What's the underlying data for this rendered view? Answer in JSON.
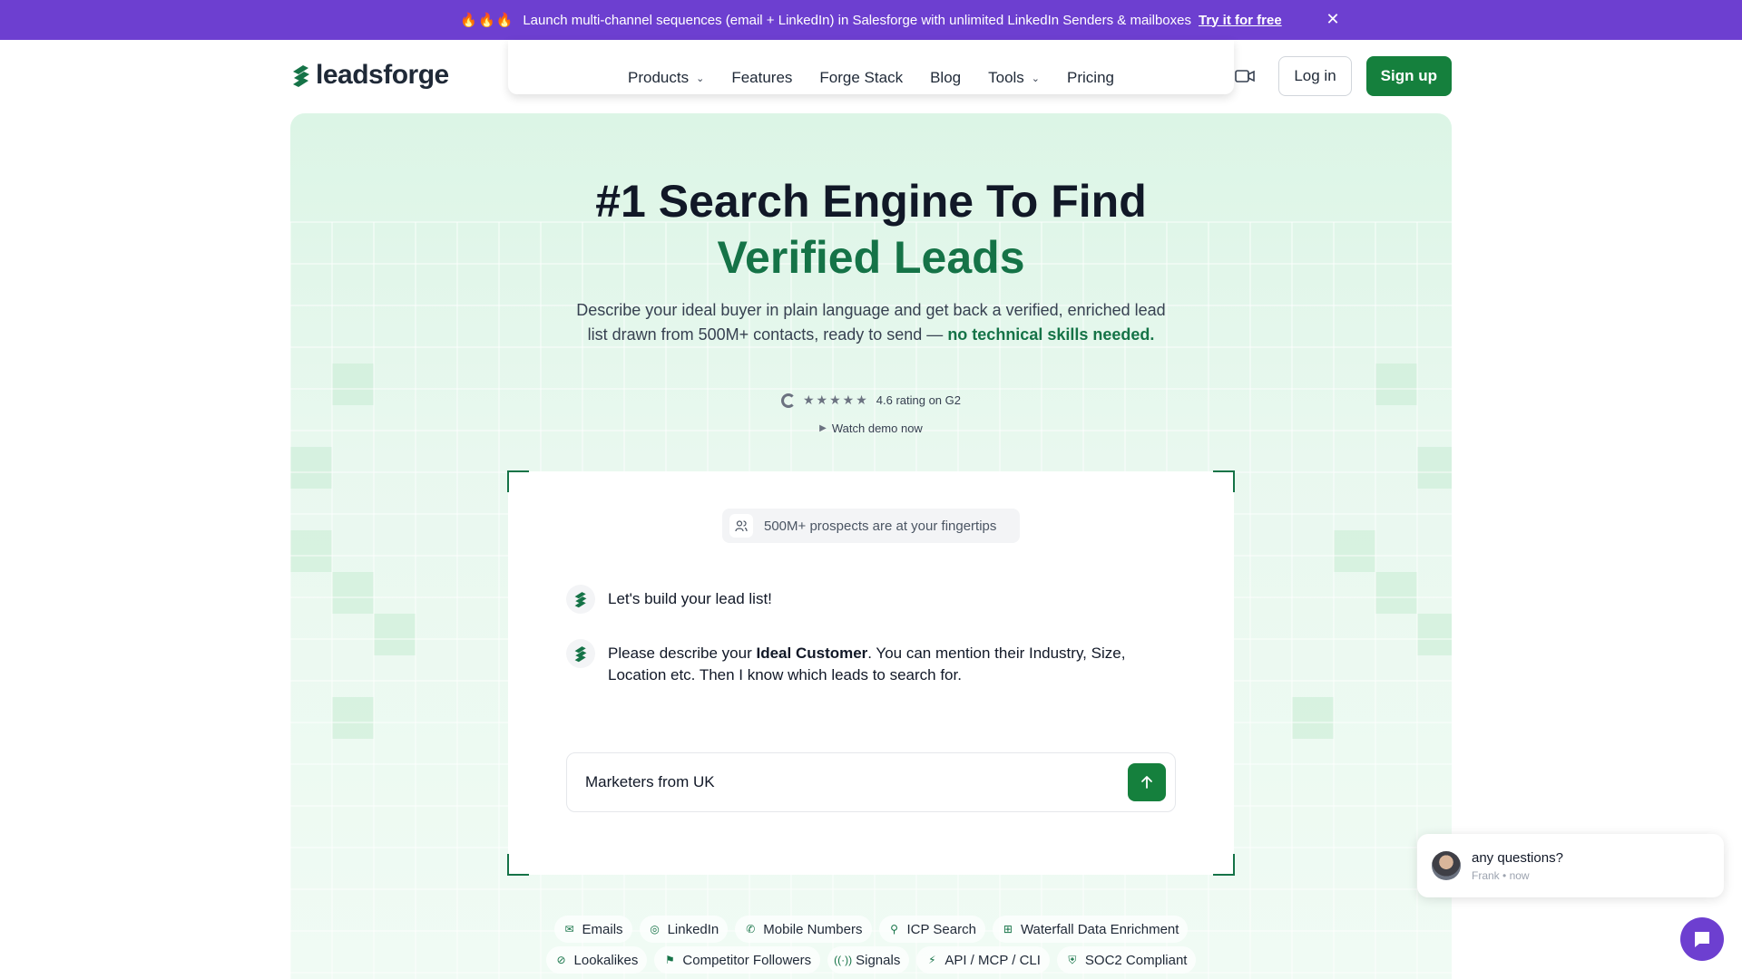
{
  "banner": {
    "fire": "🔥🔥🔥",
    "text": "Launch multi-channel sequences (email + LinkedIn) in Salesforge with unlimited LinkedIn Senders & mailboxes",
    "cta": "Try it for free",
    "close_icon": "close-icon"
  },
  "header": {
    "logo_text": "leadsforge",
    "nav": [
      {
        "label": "Products",
        "dropdown": true
      },
      {
        "label": "Features",
        "dropdown": false
      },
      {
        "label": "Forge Stack",
        "dropdown": false
      },
      {
        "label": "Blog",
        "dropdown": false
      },
      {
        "label": "Tools",
        "dropdown": true
      },
      {
        "label": "Pricing",
        "dropdown": false
      }
    ],
    "login": "Log in",
    "signup": "Sign up"
  },
  "hero": {
    "title_line1": "#1 Search Engine To Find",
    "title_line2": "Verified Leads",
    "subtitle": "Describe your ideal buyer in plain language and get back a verified, enriched lead list drawn from 500M+ contacts, ready to send —",
    "subtitle_bold": "no technical skills needed.",
    "rating": "4.6 rating on G2",
    "rating_stars": 5,
    "watch_demo": "Watch demo now"
  },
  "chat": {
    "pill": "500M+ prospects are at your fingertips",
    "msg1": "Let's build your lead list!",
    "msg2_pre": "Please describe your ",
    "msg2_bold": "Ideal Customer",
    "msg2_post": ". You can mention their Industry, Size, Location etc. Then I know which leads to search for.",
    "input_value": "Marketers from UK"
  },
  "features": {
    "row1": [
      {
        "label": "Emails",
        "icon": "mail-icon"
      },
      {
        "label": "LinkedIn",
        "icon": "linkedin-icon"
      },
      {
        "label": "Mobile Numbers",
        "icon": "phone-icon"
      },
      {
        "label": "ICP Search",
        "icon": "user-search-icon"
      },
      {
        "label": "Waterfall Data Enrichment",
        "icon": "waterfall-icon"
      }
    ],
    "row2": [
      {
        "label": "Lookalikes",
        "icon": "link-icon"
      },
      {
        "label": "Competitor Followers",
        "icon": "flag-icon"
      },
      {
        "label": "Signals",
        "icon": "signal-icon"
      },
      {
        "label": "API / MCP / CLI",
        "icon": "api-icon"
      },
      {
        "label": "SOC2 Compliant",
        "icon": "shield-icon"
      }
    ]
  },
  "chat_widget": {
    "question": "any questions?",
    "author": "Frank",
    "time": "now"
  },
  "colors": {
    "banner": "#6d3fd0",
    "brand_green": "#15803d",
    "accent_green": "#157347"
  }
}
